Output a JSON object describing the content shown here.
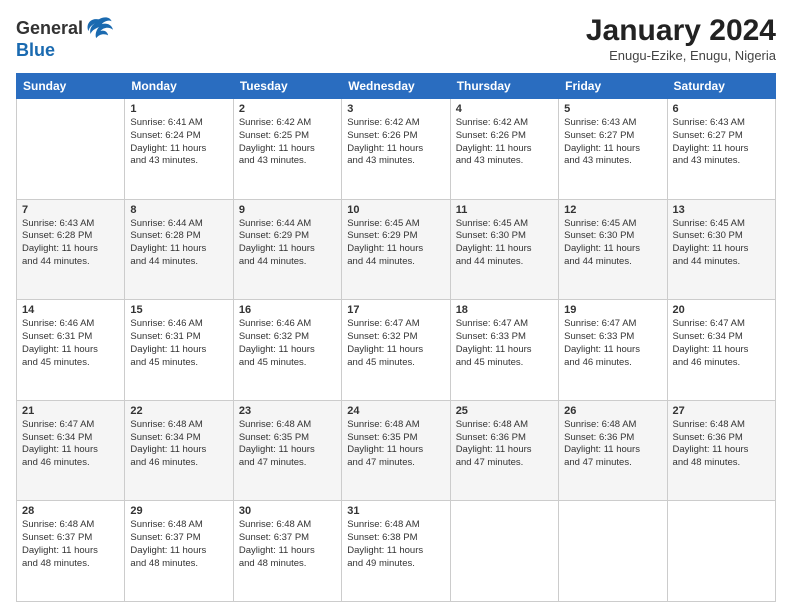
{
  "header": {
    "logo_line1": "General",
    "logo_line2": "Blue",
    "month_title": "January 2024",
    "location": "Enugu-Ezike, Enugu, Nigeria"
  },
  "columns": [
    "Sunday",
    "Monday",
    "Tuesday",
    "Wednesday",
    "Thursday",
    "Friday",
    "Saturday"
  ],
  "weeks": [
    [
      {
        "day": "",
        "lines": []
      },
      {
        "day": "1",
        "lines": [
          "Sunrise: 6:41 AM",
          "Sunset: 6:24 PM",
          "Daylight: 11 hours",
          "and 43 minutes."
        ]
      },
      {
        "day": "2",
        "lines": [
          "Sunrise: 6:42 AM",
          "Sunset: 6:25 PM",
          "Daylight: 11 hours",
          "and 43 minutes."
        ]
      },
      {
        "day": "3",
        "lines": [
          "Sunrise: 6:42 AM",
          "Sunset: 6:26 PM",
          "Daylight: 11 hours",
          "and 43 minutes."
        ]
      },
      {
        "day": "4",
        "lines": [
          "Sunrise: 6:42 AM",
          "Sunset: 6:26 PM",
          "Daylight: 11 hours",
          "and 43 minutes."
        ]
      },
      {
        "day": "5",
        "lines": [
          "Sunrise: 6:43 AM",
          "Sunset: 6:27 PM",
          "Daylight: 11 hours",
          "and 43 minutes."
        ]
      },
      {
        "day": "6",
        "lines": [
          "Sunrise: 6:43 AM",
          "Sunset: 6:27 PM",
          "Daylight: 11 hours",
          "and 43 minutes."
        ]
      }
    ],
    [
      {
        "day": "7",
        "lines": [
          "Sunrise: 6:43 AM",
          "Sunset: 6:28 PM",
          "Daylight: 11 hours",
          "and 44 minutes."
        ]
      },
      {
        "day": "8",
        "lines": [
          "Sunrise: 6:44 AM",
          "Sunset: 6:28 PM",
          "Daylight: 11 hours",
          "and 44 minutes."
        ]
      },
      {
        "day": "9",
        "lines": [
          "Sunrise: 6:44 AM",
          "Sunset: 6:29 PM",
          "Daylight: 11 hours",
          "and 44 minutes."
        ]
      },
      {
        "day": "10",
        "lines": [
          "Sunrise: 6:45 AM",
          "Sunset: 6:29 PM",
          "Daylight: 11 hours",
          "and 44 minutes."
        ]
      },
      {
        "day": "11",
        "lines": [
          "Sunrise: 6:45 AM",
          "Sunset: 6:30 PM",
          "Daylight: 11 hours",
          "and 44 minutes."
        ]
      },
      {
        "day": "12",
        "lines": [
          "Sunrise: 6:45 AM",
          "Sunset: 6:30 PM",
          "Daylight: 11 hours",
          "and 44 minutes."
        ]
      },
      {
        "day": "13",
        "lines": [
          "Sunrise: 6:45 AM",
          "Sunset: 6:30 PM",
          "Daylight: 11 hours",
          "and 44 minutes."
        ]
      }
    ],
    [
      {
        "day": "14",
        "lines": [
          "Sunrise: 6:46 AM",
          "Sunset: 6:31 PM",
          "Daylight: 11 hours",
          "and 45 minutes."
        ]
      },
      {
        "day": "15",
        "lines": [
          "Sunrise: 6:46 AM",
          "Sunset: 6:31 PM",
          "Daylight: 11 hours",
          "and 45 minutes."
        ]
      },
      {
        "day": "16",
        "lines": [
          "Sunrise: 6:46 AM",
          "Sunset: 6:32 PM",
          "Daylight: 11 hours",
          "and 45 minutes."
        ]
      },
      {
        "day": "17",
        "lines": [
          "Sunrise: 6:47 AM",
          "Sunset: 6:32 PM",
          "Daylight: 11 hours",
          "and 45 minutes."
        ]
      },
      {
        "day": "18",
        "lines": [
          "Sunrise: 6:47 AM",
          "Sunset: 6:33 PM",
          "Daylight: 11 hours",
          "and 45 minutes."
        ]
      },
      {
        "day": "19",
        "lines": [
          "Sunrise: 6:47 AM",
          "Sunset: 6:33 PM",
          "Daylight: 11 hours",
          "and 46 minutes."
        ]
      },
      {
        "day": "20",
        "lines": [
          "Sunrise: 6:47 AM",
          "Sunset: 6:34 PM",
          "Daylight: 11 hours",
          "and 46 minutes."
        ]
      }
    ],
    [
      {
        "day": "21",
        "lines": [
          "Sunrise: 6:47 AM",
          "Sunset: 6:34 PM",
          "Daylight: 11 hours",
          "and 46 minutes."
        ]
      },
      {
        "day": "22",
        "lines": [
          "Sunrise: 6:48 AM",
          "Sunset: 6:34 PM",
          "Daylight: 11 hours",
          "and 46 minutes."
        ]
      },
      {
        "day": "23",
        "lines": [
          "Sunrise: 6:48 AM",
          "Sunset: 6:35 PM",
          "Daylight: 11 hours",
          "and 47 minutes."
        ]
      },
      {
        "day": "24",
        "lines": [
          "Sunrise: 6:48 AM",
          "Sunset: 6:35 PM",
          "Daylight: 11 hours",
          "and 47 minutes."
        ]
      },
      {
        "day": "25",
        "lines": [
          "Sunrise: 6:48 AM",
          "Sunset: 6:36 PM",
          "Daylight: 11 hours",
          "and 47 minutes."
        ]
      },
      {
        "day": "26",
        "lines": [
          "Sunrise: 6:48 AM",
          "Sunset: 6:36 PM",
          "Daylight: 11 hours",
          "and 47 minutes."
        ]
      },
      {
        "day": "27",
        "lines": [
          "Sunrise: 6:48 AM",
          "Sunset: 6:36 PM",
          "Daylight: 11 hours",
          "and 48 minutes."
        ]
      }
    ],
    [
      {
        "day": "28",
        "lines": [
          "Sunrise: 6:48 AM",
          "Sunset: 6:37 PM",
          "Daylight: 11 hours",
          "and 48 minutes."
        ]
      },
      {
        "day": "29",
        "lines": [
          "Sunrise: 6:48 AM",
          "Sunset: 6:37 PM",
          "Daylight: 11 hours",
          "and 48 minutes."
        ]
      },
      {
        "day": "30",
        "lines": [
          "Sunrise: 6:48 AM",
          "Sunset: 6:37 PM",
          "Daylight: 11 hours",
          "and 48 minutes."
        ]
      },
      {
        "day": "31",
        "lines": [
          "Sunrise: 6:48 AM",
          "Sunset: 6:38 PM",
          "Daylight: 11 hours",
          "and 49 minutes."
        ]
      },
      {
        "day": "",
        "lines": []
      },
      {
        "day": "",
        "lines": []
      },
      {
        "day": "",
        "lines": []
      }
    ]
  ]
}
